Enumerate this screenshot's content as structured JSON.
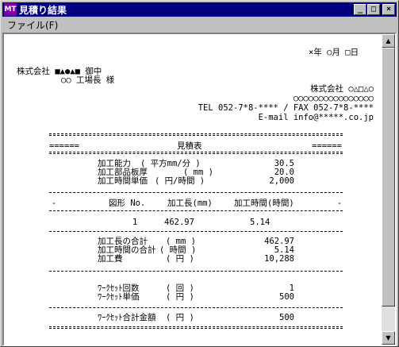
{
  "window": {
    "icon_text": "MT",
    "title": "見積り結果",
    "buttons": {
      "minimize": "_",
      "maximize": "□",
      "close": "×"
    }
  },
  "menu": {
    "file": "ファイル(F)"
  },
  "header": {
    "date": "×年 ○月 □日",
    "recipient_company": "株式会社 ■▲●▲■ 御中",
    "recipient_person": "○○ 工場長 様",
    "sender_company": "株式会社 ○△□△○",
    "sender_address": "○○○○○○○○○○○○○○○○",
    "tel_fax": "TEL 052-7*8-**** / FAX 052-7*8-****",
    "email": "E-mail info@*****.co.jp"
  },
  "estimate": {
    "section_marker": "======",
    "title": "見積表",
    "params": [
      {
        "label": "加工能力",
        "unit": "( 平方mm/分 )",
        "value": "30.5"
      },
      {
        "label": "加工部品板厚",
        "unit": "( mm )",
        "value": "20.0"
      },
      {
        "label": "加工時間単価",
        "unit": "( 円/時間 )",
        "value": "2,000"
      }
    ],
    "table": {
      "headers": [
        "-",
        "図形 No.",
        "加工長(mm)",
        "加工時間(時間)",
        "-"
      ],
      "rows": [
        {
          "no": "1",
          "length": "462.97",
          "time": "5.14"
        }
      ]
    },
    "totals": [
      {
        "label": "加工長の合計",
        "unit": "( mm )",
        "value": "462.97"
      },
      {
        "label": "加工時間の合計",
        "unit": "( 時間 )",
        "value": "5.14"
      },
      {
        "label": "加工費",
        "unit": "( 円 )",
        "value": "10,288"
      }
    ],
    "workset": [
      {
        "label": "ﾜｰｸｾｯﾄ回数",
        "unit": "( 回 )",
        "value": "1"
      },
      {
        "label": "ﾜｰｸｾｯﾄ単価",
        "unit": "( 円 )",
        "value": "500"
      }
    ],
    "workset_total": {
      "label": "ﾜｰｸｾｯﾄ合計金額",
      "unit": "( 円 )",
      "value": "500"
    }
  }
}
